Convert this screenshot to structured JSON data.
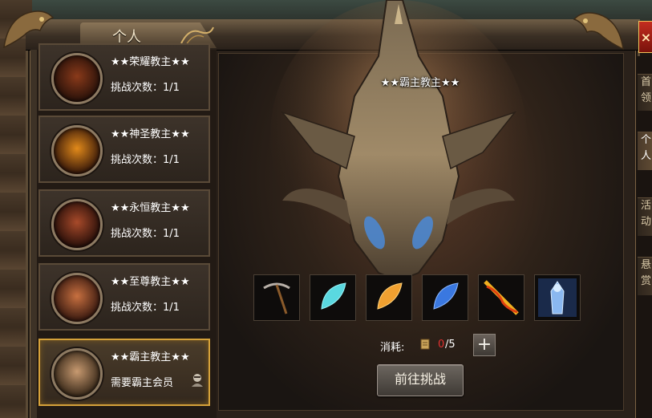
{
  "window": {
    "tab_label": "个人",
    "close_label": "×"
  },
  "side_tabs": [
    "首领",
    "个人",
    "活动",
    "悬赏"
  ],
  "boss_list": [
    {
      "name": "★★荣耀教主★★",
      "status": "挑战次数：1/1"
    },
    {
      "name": "★★神圣教主★★",
      "status": "挑战次数：1/1"
    },
    {
      "name": "★★永恒教主★★",
      "status": "挑战次数：1/1"
    },
    {
      "name": "★★至尊教主★★",
      "status": "挑战次数：1/1"
    },
    {
      "name": "★★霸主教主★★",
      "status": "需要霸主会员"
    }
  ],
  "detail": {
    "boss_name": "★★霸主教主★★",
    "rewards": [
      "pickaxe-icon",
      "cyan-feather-icon",
      "orange-feather-icon",
      "blue-feather-icon",
      "flame-sword-icon",
      "ice-armor-icon"
    ],
    "cost_label": "消耗:",
    "cost_have": "0",
    "cost_need": "/5",
    "plus_label": "+",
    "challenge_button": "前往挑战"
  },
  "colors": {
    "accent_gold": "#d6a23a",
    "insufficient_red": "#e23030"
  }
}
